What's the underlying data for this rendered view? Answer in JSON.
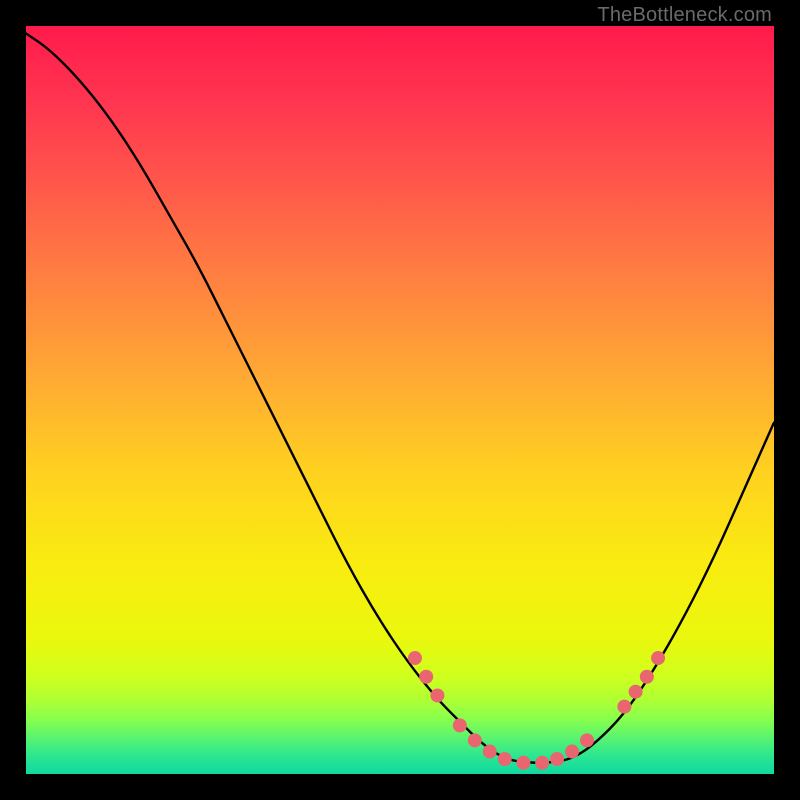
{
  "watermark": "TheBottleneck.com",
  "colors": {
    "frame": "#000000",
    "curve": "#000000",
    "dot_fill": "#e96670",
    "gradient_stops": [
      {
        "offset": 0.0,
        "color": "#ff1a4b"
      },
      {
        "offset": 0.1,
        "color": "#ff3550"
      },
      {
        "offset": 0.22,
        "color": "#ff5a4a"
      },
      {
        "offset": 0.35,
        "color": "#ff8440"
      },
      {
        "offset": 0.48,
        "color": "#ffad33"
      },
      {
        "offset": 0.6,
        "color": "#ffd21f"
      },
      {
        "offset": 0.72,
        "color": "#f9ec10"
      },
      {
        "offset": 0.82,
        "color": "#eaf80d"
      },
      {
        "offset": 0.87,
        "color": "#ceff1e"
      },
      {
        "offset": 0.9,
        "color": "#b0ff33"
      },
      {
        "offset": 0.925,
        "color": "#8aff4a"
      },
      {
        "offset": 0.95,
        "color": "#5cf56e"
      },
      {
        "offset": 0.975,
        "color": "#2de78f"
      },
      {
        "offset": 1.0,
        "color": "#0fd8a0"
      }
    ]
  },
  "chart_data": {
    "type": "line",
    "title": "",
    "xlabel": "",
    "ylabel": "",
    "xlim": [
      0,
      100
    ],
    "ylim": [
      0,
      100
    ],
    "series": [
      {
        "name": "curve",
        "x": [
          0,
          3,
          7,
          11,
          15,
          19,
          23,
          27,
          31,
          35,
          39,
          43,
          47,
          51,
          55,
          58,
          61,
          64,
          67,
          70,
          73,
          76,
          80,
          84,
          88,
          92,
          96,
          100
        ],
        "y": [
          99,
          97,
          93,
          88,
          82,
          75,
          68,
          60,
          52,
          44,
          36,
          28,
          21,
          15,
          10,
          7,
          4,
          2,
          1.5,
          1.5,
          2,
          4,
          8,
          14,
          21,
          29,
          38,
          47
        ]
      }
    ],
    "points": [
      {
        "x": 52,
        "y": 15.5
      },
      {
        "x": 53.5,
        "y": 13
      },
      {
        "x": 55,
        "y": 10.5
      },
      {
        "x": 58,
        "y": 6.5
      },
      {
        "x": 60,
        "y": 4.5
      },
      {
        "x": 62,
        "y": 3
      },
      {
        "x": 64,
        "y": 2
      },
      {
        "x": 66.5,
        "y": 1.5
      },
      {
        "x": 69,
        "y": 1.5
      },
      {
        "x": 71,
        "y": 2
      },
      {
        "x": 73,
        "y": 3
      },
      {
        "x": 75,
        "y": 4.5
      },
      {
        "x": 80,
        "y": 9
      },
      {
        "x": 81.5,
        "y": 11
      },
      {
        "x": 83,
        "y": 13
      },
      {
        "x": 84.5,
        "y": 15.5
      }
    ]
  }
}
